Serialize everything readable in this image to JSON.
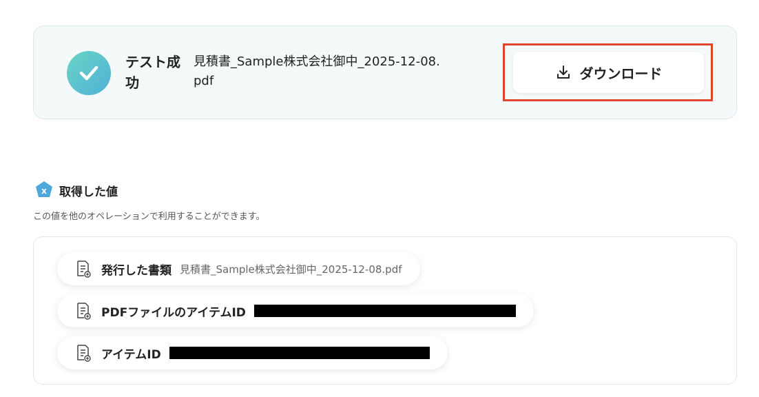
{
  "result": {
    "status": "テスト成功",
    "file_name": "見積書_Sample株式会社御中_2025-12-08.pdf",
    "download_label": "ダウンロード"
  },
  "section": {
    "title": "取得した値",
    "description": "この値を他のオペレーションで利用することができます。"
  },
  "values": [
    {
      "label": "発行した書類",
      "value": "見積書_Sample株式会社御中_2025-12-08.pdf",
      "redacted": false
    },
    {
      "label": "PDFファイルのアイテムID",
      "value": "",
      "redacted": true
    },
    {
      "label": "アイテムID",
      "value": "",
      "redacted": true
    }
  ],
  "colors": {
    "highlight": "#e2432b",
    "success_gradient_start": "#6ad5c4",
    "success_gradient_end": "#4fb0d8",
    "card_background": "#f4f9f9"
  }
}
